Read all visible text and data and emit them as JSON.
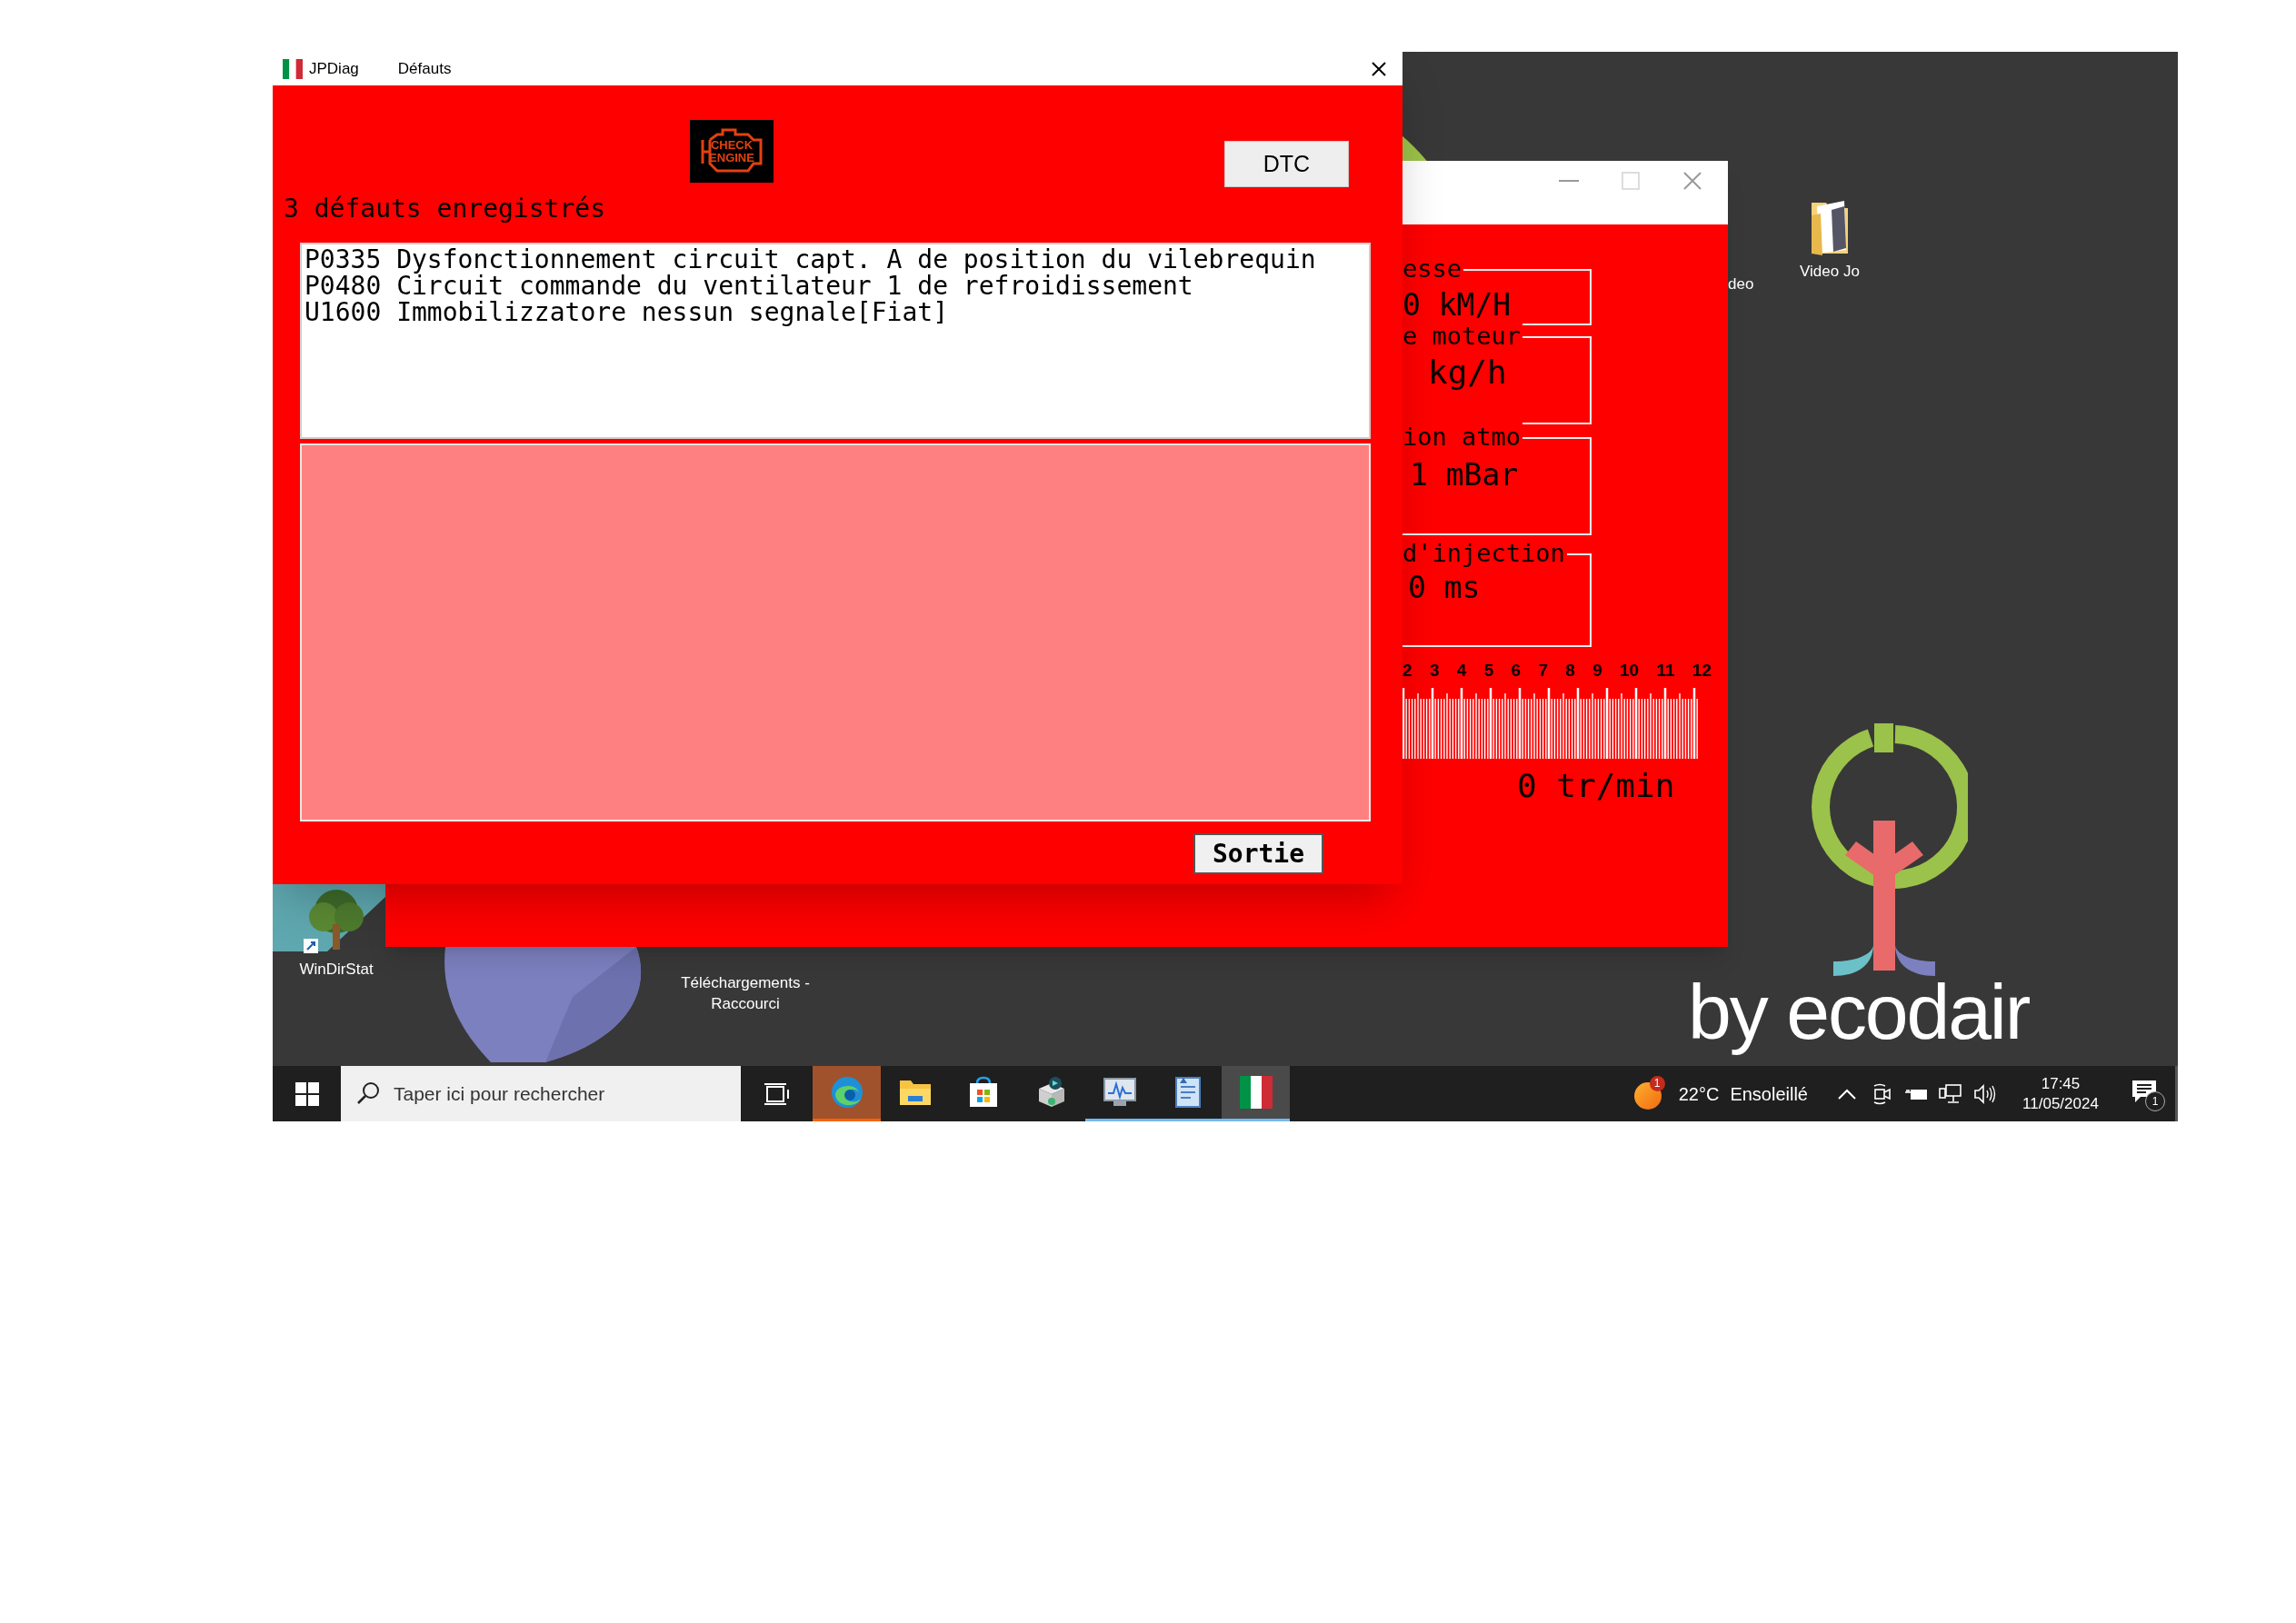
{
  "window": {
    "app_name": "JPDiag",
    "title": "Défauts",
    "warning_light": [
      "CHECK",
      "ENGINE"
    ],
    "dtc_button": "DTC",
    "fault_count": "3 défauts enregistrés",
    "faults": [
      {
        "text": "P0335 Dysfonctionnement circuit capt. A de position du vilebrequin"
      },
      {
        "text": "P0480 Circuit commande du ventilateur 1 de refroidissement"
      },
      {
        "text": "U1600 Immobilizzatore nessun segnale[Fiat]"
      }
    ],
    "exit_button": "Sortie"
  },
  "background_window": {
    "gauges": [
      {
        "label": "esse",
        "value": "0 kM/H"
      },
      {
        "label": "e moteur",
        "value": "kg/h"
      },
      {
        "label": "ion atmo",
        "value": "1 mBar"
      },
      {
        "label": "d'injection",
        "value": "0 ms"
      }
    ],
    "rpm_ticks": [
      "2",
      "3",
      "4",
      "5",
      "6",
      "7",
      "8",
      "9",
      "10",
      "11",
      "12"
    ],
    "rpm_reading": "0 tr/min"
  },
  "desktop_icons": [
    {
      "kind": "partial",
      "label": "deo"
    },
    {
      "kind": "folder",
      "label": "Video Jo"
    },
    {
      "kind": "tree",
      "label": "WinDirStat"
    },
    {
      "kind": "hidden",
      "label": "Téléchargements - Raccourci"
    }
  ],
  "wallpaper": {
    "brand": "by ecodair"
  },
  "taskbar": {
    "search": {
      "placeholder": "Taper ici pour rechercher"
    },
    "apps": [
      {
        "kind": "edge",
        "flashing": true,
        "running": true,
        "selected": false
      },
      {
        "kind": "explorer",
        "flashing": false,
        "running": false,
        "selected": false
      },
      {
        "kind": "store",
        "flashing": false,
        "running": false,
        "selected": false
      },
      {
        "kind": "box",
        "flashing": false,
        "running": false,
        "selected": false
      },
      {
        "kind": "monitor",
        "flashing": false,
        "running": true,
        "selected": false
      },
      {
        "kind": "notes",
        "flashing": false,
        "running": true,
        "selected": false
      },
      {
        "kind": "flag",
        "flashing": false,
        "running": true,
        "selected": true
      }
    ],
    "weather": {
      "badge": "1",
      "temperature": "22°C",
      "condition": "Ensoleillé"
    },
    "clock": {
      "time": "17:45",
      "date": "11/05/2024"
    },
    "notifications": {
      "badge": "1"
    }
  }
}
